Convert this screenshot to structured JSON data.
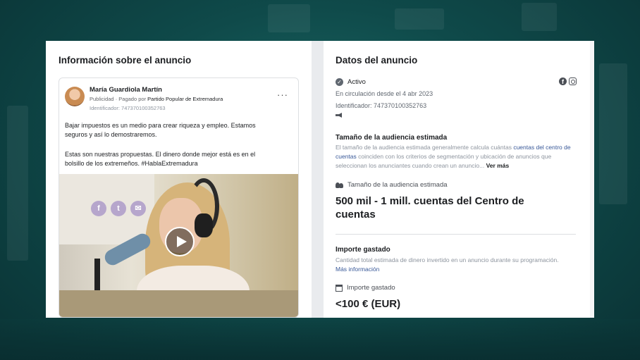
{
  "left_panel": {
    "title": "Información sobre el anuncio",
    "ad": {
      "page_name": "María Guardiola Martín",
      "sponsored_label": "Publicidad",
      "paid_by_prefix": "· Pagado por",
      "paid_by": "Partido Popular de Extremadura",
      "identifier": "Identificador: 747370100352763",
      "paragraph_1": "Bajar impuestos es un medio para crear riqueza y empleo. Estamos seguros y así lo demostraremos.",
      "paragraph_2": "Estas son nuestras propuestas. El dinero donde mejor está es en el bolsillo de los extremeños. #HablaExtremadura",
      "more_icon": "more-dots-icon",
      "media_icon": "play-icon",
      "social_glyphs": [
        "f",
        "t",
        "✉"
      ]
    }
  },
  "right_panel": {
    "title": "Datos del anuncio",
    "status": "Activo",
    "running_since": "En circulación desde el 4 abr 2023",
    "identifier": "Identificador: 747370100352763",
    "platforms": [
      "facebook-icon",
      "instagram-icon"
    ],
    "audience_section": {
      "title": "Tamaño de la audiencia estimada",
      "desc_before_link": "El tamaño de la audiencia estimada generalmente calcula cuántas ",
      "desc_link": "cuentas del centro de cuentas",
      "desc_after_link": " coinciden con los criterios de segmentación y ubicación de anuncios que seleccionan los anunciantes cuando crean un anuncio...",
      "see_more": "Ver más",
      "metric_label": "Tamaño de la audiencia estimada",
      "metric_value": "500 mil - 1 mill. cuentas del Centro de cuentas"
    },
    "spend_section": {
      "title": "Importe gastado",
      "desc": "Cantidad total estimada de dinero invertido en un anuncio durante su programación. ",
      "desc_link": "Más información",
      "metric_label": "Importe gastado",
      "metric_value": "<100 € (EUR)"
    }
  }
}
